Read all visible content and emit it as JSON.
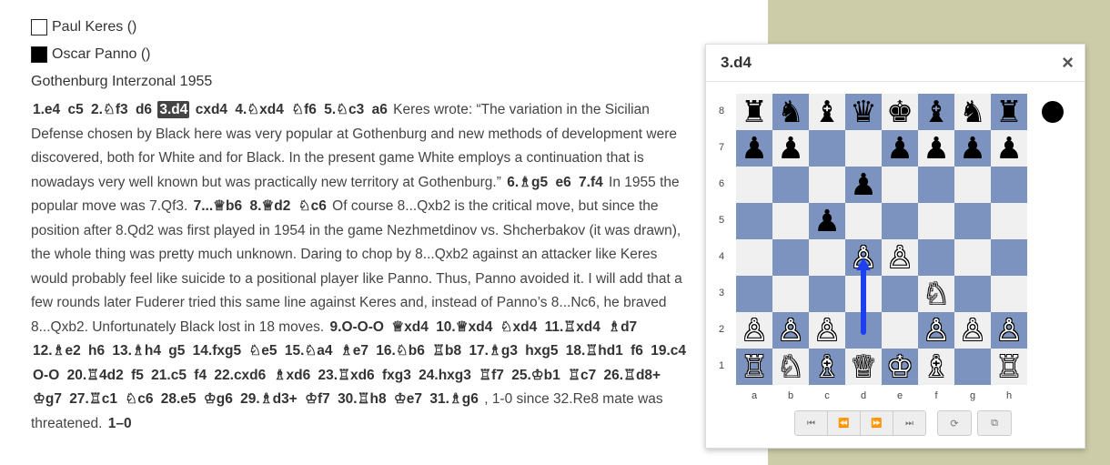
{
  "game": {
    "white_player": "Paul Keres ()",
    "black_player": "Oscar Panno ()",
    "event": "Gothenburg Interzonal 1955"
  },
  "moves": [
    {
      "t": "mv",
      "s": "1.e4"
    },
    {
      "t": "mv",
      "s": "c5"
    },
    {
      "t": "mv",
      "s": "2.♘f3"
    },
    {
      "t": "mv",
      "s": "d6"
    },
    {
      "t": "mv",
      "s": "3.d4",
      "current": true
    },
    {
      "t": "mv",
      "s": "cxd4"
    },
    {
      "t": "mv",
      "s": "4.♘xd4"
    },
    {
      "t": "mv",
      "s": "♘f6"
    },
    {
      "t": "mv",
      "s": "5.♘c3"
    },
    {
      "t": "mv",
      "s": "a6"
    },
    {
      "t": "cmt",
      "s": "Keres wrote: “The variation in the Sicilian Defense chosen by Black here was very popular at Gothenburg and new methods of development were discovered, both for White and for Black. In the present game White employs a continuation that is nowadays very well known but was practically new territory at Gothenburg.”"
    },
    {
      "t": "mv",
      "s": "6.♗g5"
    },
    {
      "t": "mv",
      "s": "e6"
    },
    {
      "t": "mv",
      "s": "7.f4"
    },
    {
      "t": "cmt",
      "s": "In 1955 the popular move was 7.Qf3."
    },
    {
      "t": "mv",
      "s": "7...♕b6"
    },
    {
      "t": "mv",
      "s": "8.♕d2"
    },
    {
      "t": "mv",
      "s": "♘c6"
    },
    {
      "t": "cmt",
      "s": "Of course 8...Qxb2 is the critical move, but since the position after 8.Qd2 was first played in 1954 in the game Nezhmetdinov vs. Shcherbakov (it was drawn), the whole thing was pretty much unknown. Daring to chop by 8...Qxb2 against an attacker like Keres would probably feel like suicide to a positional player like Panno. Thus, Panno avoided it. I will add that a few rounds later Fuderer tried this same line against Keres and, instead of Panno’s 8...Nc6, he braved 8...Qxb2. Unfortunately Black lost in 18 moves."
    },
    {
      "t": "mv",
      "s": "9.O-O-O"
    },
    {
      "t": "mv",
      "s": "♕xd4"
    },
    {
      "t": "mv",
      "s": "10.♕xd4"
    },
    {
      "t": "mv",
      "s": "♘xd4"
    },
    {
      "t": "mv",
      "s": "11.♖xd4"
    },
    {
      "t": "mv",
      "s": "♗d7"
    },
    {
      "t": "mv",
      "s": "12.♗e2"
    },
    {
      "t": "mv",
      "s": "h6"
    },
    {
      "t": "mv",
      "s": "13.♗h4"
    },
    {
      "t": "mv",
      "s": "g5"
    },
    {
      "t": "mv",
      "s": "14.fxg5"
    },
    {
      "t": "mv",
      "s": "♘e5"
    },
    {
      "t": "mv",
      "s": "15.♘a4"
    },
    {
      "t": "mv",
      "s": "♗e7"
    },
    {
      "t": "mv",
      "s": "16.♘b6"
    },
    {
      "t": "mv",
      "s": "♖b8"
    },
    {
      "t": "mv",
      "s": "17.♗g3"
    },
    {
      "t": "mv",
      "s": "hxg5"
    },
    {
      "t": "mv",
      "s": "18.♖hd1"
    },
    {
      "t": "mv",
      "s": "f6"
    },
    {
      "t": "mv",
      "s": "19.c4"
    },
    {
      "t": "mv",
      "s": "O-O"
    },
    {
      "t": "mv",
      "s": "20.♖4d2"
    },
    {
      "t": "mv",
      "s": "f5"
    },
    {
      "t": "mv",
      "s": "21.c5"
    },
    {
      "t": "mv",
      "s": "f4"
    },
    {
      "t": "mv",
      "s": "22.cxd6"
    },
    {
      "t": "mv",
      "s": "♗xd6"
    },
    {
      "t": "mv",
      "s": "23.♖xd6"
    },
    {
      "t": "mv",
      "s": "fxg3"
    },
    {
      "t": "mv",
      "s": "24.hxg3"
    },
    {
      "t": "mv",
      "s": "♖f7"
    },
    {
      "t": "mv",
      "s": "25.♔b1"
    },
    {
      "t": "mv",
      "s": "♖c7"
    },
    {
      "t": "mv",
      "s": "26.♖d8+"
    },
    {
      "t": "mv",
      "s": "♔g7"
    },
    {
      "t": "mv",
      "s": "27.♖c1"
    },
    {
      "t": "mv",
      "s": "♘c6"
    },
    {
      "t": "mv",
      "s": "28.e5"
    },
    {
      "t": "mv",
      "s": "♔g6"
    },
    {
      "t": "mv",
      "s": "29.♗d3+"
    },
    {
      "t": "mv",
      "s": "♔f7"
    },
    {
      "t": "mv",
      "s": "30.♖h8"
    },
    {
      "t": "mv",
      "s": "♔e7"
    },
    {
      "t": "mv",
      "s": "31.♗g6"
    },
    {
      "t": "cmt",
      "s": ", 1-0 since 32.Re8 mate was threatened."
    },
    {
      "t": "mv",
      "s": "1–0"
    }
  ],
  "panel": {
    "title": "3.d4",
    "close_symbol": "×",
    "side_to_move": "black"
  },
  "board": {
    "ranks": [
      "8",
      "7",
      "6",
      "5",
      "4",
      "3",
      "2",
      "1"
    ],
    "files": [
      "a",
      "b",
      "c",
      "d",
      "e",
      "f",
      "g",
      "h"
    ],
    "position": [
      [
        "r",
        "n",
        "b",
        "q",
        "k",
        "b",
        "n",
        "r"
      ],
      [
        "p",
        "p",
        "",
        "",
        "p",
        "p",
        "p",
        "p"
      ],
      [
        "",
        "",
        "",
        "p",
        "",
        "",
        "",
        ""
      ],
      [
        "",
        "",
        "p",
        "",
        "",
        "",
        "",
        ""
      ],
      [
        "",
        "",
        "",
        "P",
        "P",
        "",
        "",
        ""
      ],
      [
        "",
        "",
        "",
        "",
        "",
        "N",
        "",
        ""
      ],
      [
        "P",
        "P",
        "P",
        "",
        "",
        "P",
        "P",
        "P"
      ],
      [
        "R",
        "N",
        "B",
        "Q",
        "K",
        "B",
        "",
        "R"
      ]
    ],
    "last_move": {
      "from": "d2",
      "to": "d4"
    },
    "colors": {
      "light": "#f0f0f0",
      "dark": "#7b93be",
      "arrow": "#1c3ff0"
    }
  },
  "controls": {
    "nav": [
      "⏮",
      "⏪",
      "⏩",
      "⏭"
    ],
    "flip": "⟳",
    "external": "⧉"
  }
}
